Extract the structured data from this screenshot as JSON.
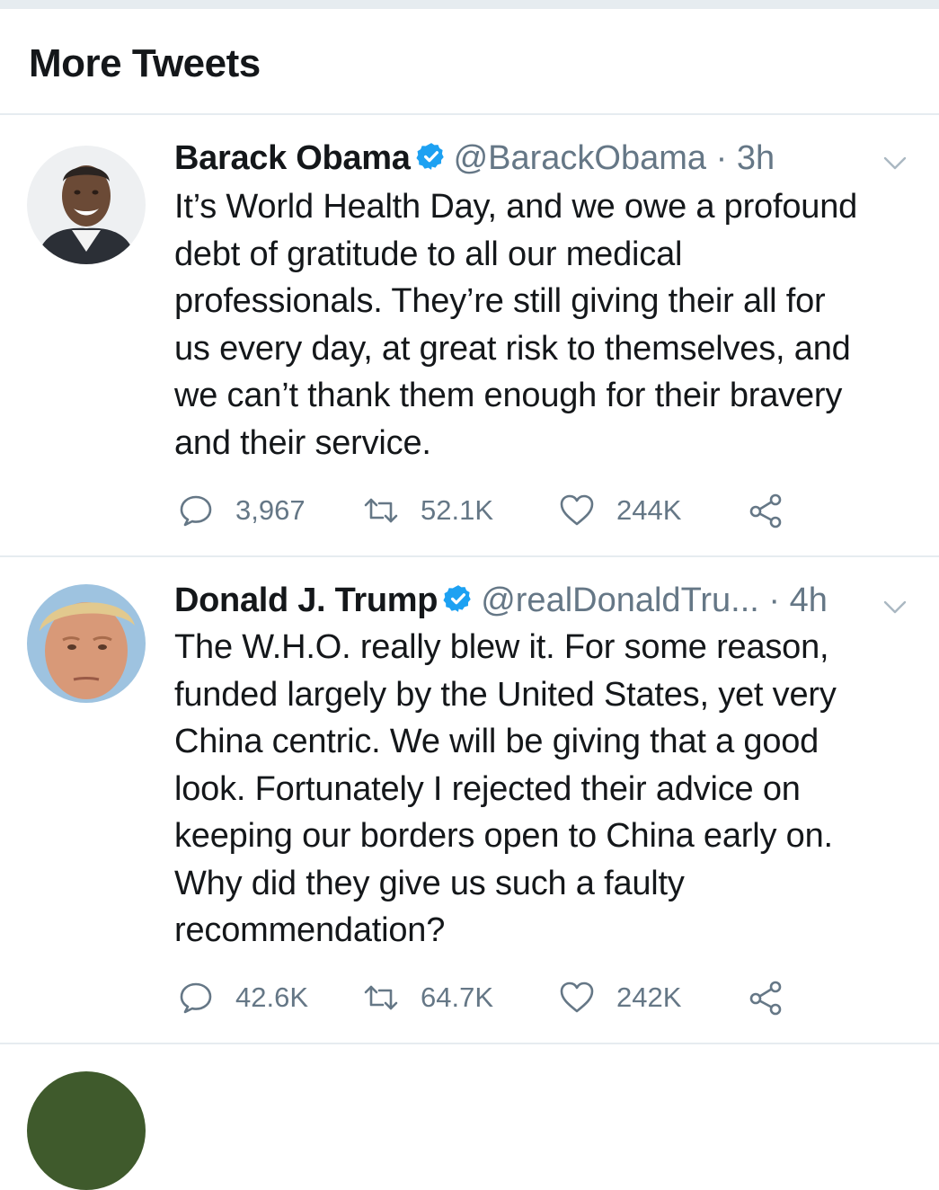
{
  "header": {
    "title": "More Tweets"
  },
  "colors": {
    "text": "#14171a",
    "secondary": "#657786",
    "divider": "#e6ecf0",
    "verified": "#1da1f2"
  },
  "tweets": [
    {
      "name": "Barack Obama",
      "verified": true,
      "handle": "@BarackObama",
      "separator": "·",
      "time": "3h",
      "text": "It’s World Health Day, and we owe a profound\ndebt of gratitude to all our medical\nprofessionals. They’re still giving their all for\nus every day, at great risk to themselves, and\nwe can’t thank them enough for their bravery\nand their service.",
      "replies": "3,967",
      "retweets": "52.1K",
      "likes": "244K",
      "icons": [
        "reply-icon",
        "retweet-icon",
        "like-icon",
        "share-icon",
        "chevron-down-icon",
        "verified-badge-icon"
      ]
    },
    {
      "name": "Donald J. Trump",
      "verified": true,
      "handle": "@realDonaldTru...",
      "separator": "·",
      "time": "4h",
      "text": "The W.H.O. really blew it. For some reason,\nfunded largely by the United States, yet very\nChina centric. We will be giving that a good\nlook. Fortunately I rejected their advice on\nkeeping our borders open to China early on.\nWhy did they give us such a faulty\nrecommendation?",
      "replies": "42.6K",
      "retweets": "64.7K",
      "likes": "242K",
      "icons": [
        "reply-icon",
        "retweet-icon",
        "like-icon",
        "share-icon",
        "chevron-down-icon",
        "verified-badge-icon"
      ]
    }
  ]
}
